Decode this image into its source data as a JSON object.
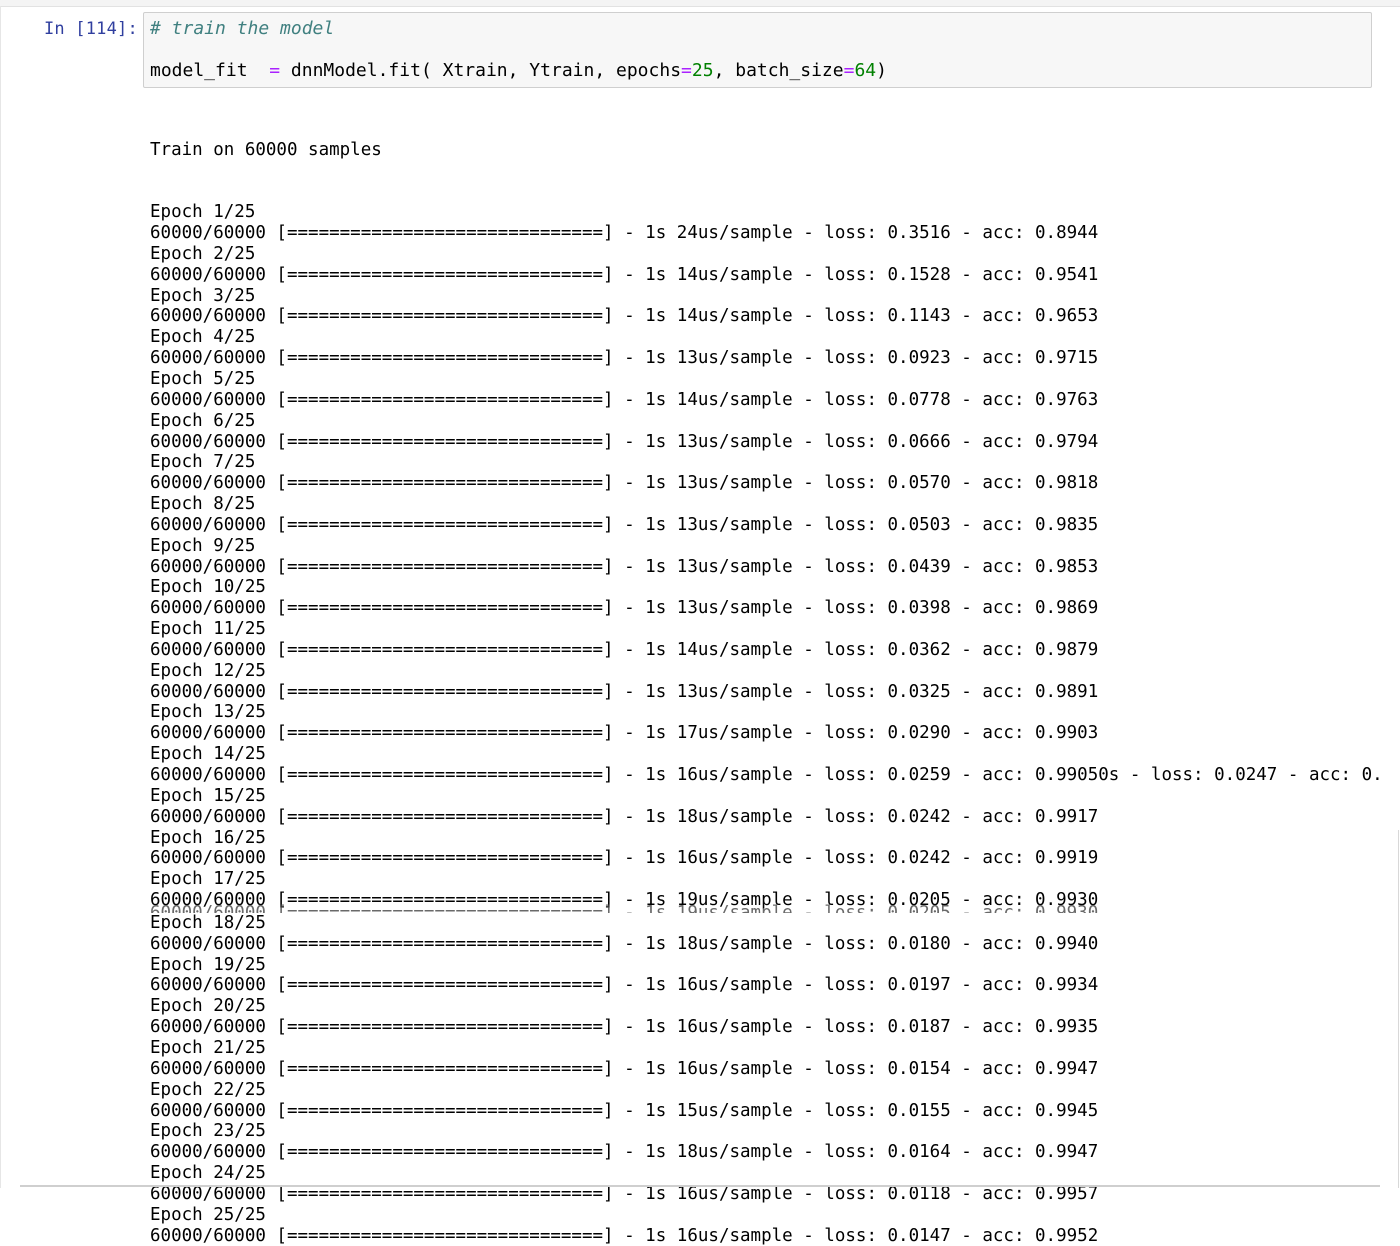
{
  "cell": {
    "prompt": "In [114]:",
    "code": {
      "comment": "# train the model",
      "line2_a": "model_fit  ",
      "line2_op1": "=",
      "line2_b": " dnnModel.fit( Xtrain, Ytrain, epochs",
      "line2_op2": "=",
      "line2_num1": "25",
      "line2_c": ", batch_size",
      "line2_op3": "=",
      "line2_num2": "64",
      "line2_d": ")"
    }
  },
  "output": {
    "header": "Train on 60000 samples",
    "epochs": [
      {
        "epoch": "Epoch 1/25",
        "progress": "60000/60000 [==============================] - 1s 24us/sample - loss: 0.3516 - acc: 0.8944"
      },
      {
        "epoch": "Epoch 2/25",
        "progress": "60000/60000 [==============================] - 1s 14us/sample - loss: 0.1528 - acc: 0.9541"
      },
      {
        "epoch": "Epoch 3/25",
        "progress": "60000/60000 [==============================] - 1s 14us/sample - loss: 0.1143 - acc: 0.9653"
      },
      {
        "epoch": "Epoch 4/25",
        "progress": "60000/60000 [==============================] - 1s 13us/sample - loss: 0.0923 - acc: 0.9715"
      },
      {
        "epoch": "Epoch 5/25",
        "progress": "60000/60000 [==============================] - 1s 14us/sample - loss: 0.0778 - acc: 0.9763"
      },
      {
        "epoch": "Epoch 6/25",
        "progress": "60000/60000 [==============================] - 1s 13us/sample - loss: 0.0666 - acc: 0.9794"
      },
      {
        "epoch": "Epoch 7/25",
        "progress": "60000/60000 [==============================] - 1s 13us/sample - loss: 0.0570 - acc: 0.9818"
      },
      {
        "epoch": "Epoch 8/25",
        "progress": "60000/60000 [==============================] - 1s 13us/sample - loss: 0.0503 - acc: 0.9835"
      },
      {
        "epoch": "Epoch 9/25",
        "progress": "60000/60000 [==============================] - 1s 13us/sample - loss: 0.0439 - acc: 0.9853"
      },
      {
        "epoch": "Epoch 10/25",
        "progress": "60000/60000 [==============================] - 1s 13us/sample - loss: 0.0398 - acc: 0.9869"
      },
      {
        "epoch": "Epoch 11/25",
        "progress": "60000/60000 [==============================] - 1s 14us/sample - loss: 0.0362 - acc: 0.9879"
      },
      {
        "epoch": "Epoch 12/25",
        "progress": "60000/60000 [==============================] - 1s 13us/sample - loss: 0.0325 - acc: 0.9891"
      },
      {
        "epoch": "Epoch 13/25",
        "progress": "60000/60000 [==============================] - 1s 17us/sample - loss: 0.0290 - acc: 0.9903"
      },
      {
        "epoch": "Epoch 14/25",
        "progress": "60000/60000 [==============================] - 1s 16us/sample - loss: 0.0259 - acc: 0.99050s - loss: 0.0247 - acc: 0."
      },
      {
        "epoch": "Epoch 15/25",
        "progress": "60000/60000 [==============================] - 1s 18us/sample - loss: 0.0242 - acc: 0.9917"
      },
      {
        "epoch": "Epoch 16/25",
        "progress": "60000/60000 [==============================] - 1s 16us/sample - loss: 0.0242 - acc: 0.9919"
      },
      {
        "epoch": "Epoch 17/25",
        "progress": "60000/60000 [==============================] - 1s 19us/sample - loss: 0.0205 - acc: 0.9930"
      },
      {
        "epoch": "Epoch 18/25",
        "progress": "60000/60000 [==============================] - 1s 18us/sample - loss: 0.0180 - acc: 0.9940"
      },
      {
        "epoch": "Epoch 19/25",
        "progress": "60000/60000 [==============================] - 1s 16us/sample - loss: 0.0197 - acc: 0.9934"
      },
      {
        "epoch": "Epoch 20/25",
        "progress": "60000/60000 [==============================] - 1s 16us/sample - loss: 0.0187 - acc: 0.9935"
      },
      {
        "epoch": "Epoch 21/25",
        "progress": "60000/60000 [==============================] - 1s 16us/sample - loss: 0.0154 - acc: 0.9947"
      },
      {
        "epoch": "Epoch 22/25",
        "progress": "60000/60000 [==============================] - 1s 15us/sample - loss: 0.0155 - acc: 0.9945"
      },
      {
        "epoch": "Epoch 23/25",
        "progress": "60000/60000 [==============================] - 1s 18us/sample - loss: 0.0164 - acc: 0.9947"
      },
      {
        "epoch": "Epoch 24/25",
        "progress": "60000/60000 [==============================] - 1s 16us/sample - loss: 0.0118 - acc: 0.9957"
      },
      {
        "epoch": "Epoch 25/25",
        "progress": "60000/60000 [==============================] - 1s 16us/sample - loss: 0.0147 - acc: 0.9952"
      }
    ]
  }
}
